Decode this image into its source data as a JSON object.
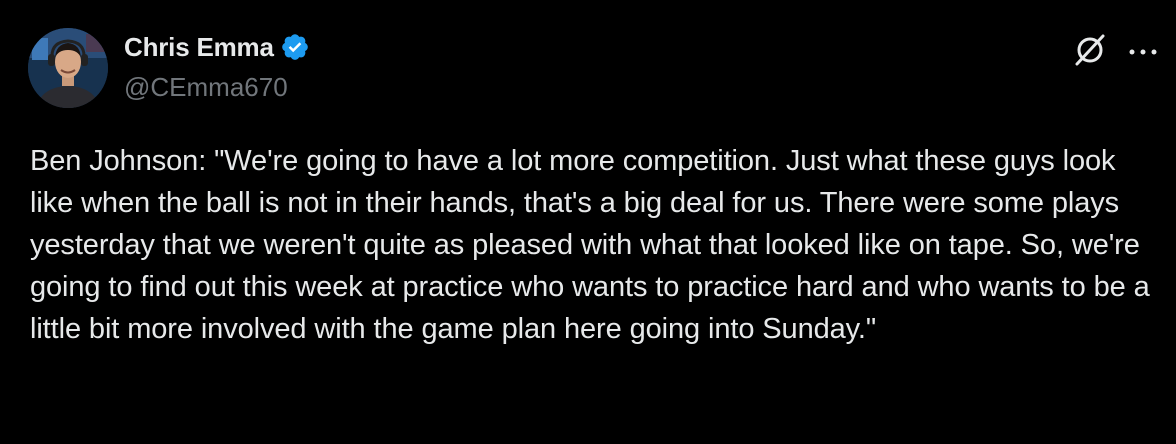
{
  "author": {
    "display_name": "Chris Emma",
    "handle": "@CEmma670",
    "verified": true,
    "verified_color": "#1d9bf0",
    "avatar_icon": "profile-photo"
  },
  "actions": {
    "grok_icon": "grok-icon",
    "more_icon": "more-dots-icon"
  },
  "tweet": {
    "text": "Ben Johnson: \"We're going to have a lot more competition. Just what these guys look like when the ball is not in their hands, that's a big deal for us. There were some plays yesterday that we weren't quite as pleased with what that looked like on tape. So, we're going to find out this week at practice who wants to practice hard and who wants to be a little bit more involved with the game plan here going into Sunday.\""
  },
  "colors": {
    "background": "#000000",
    "text_primary": "#e7e9ea",
    "text_secondary": "#71767b"
  }
}
